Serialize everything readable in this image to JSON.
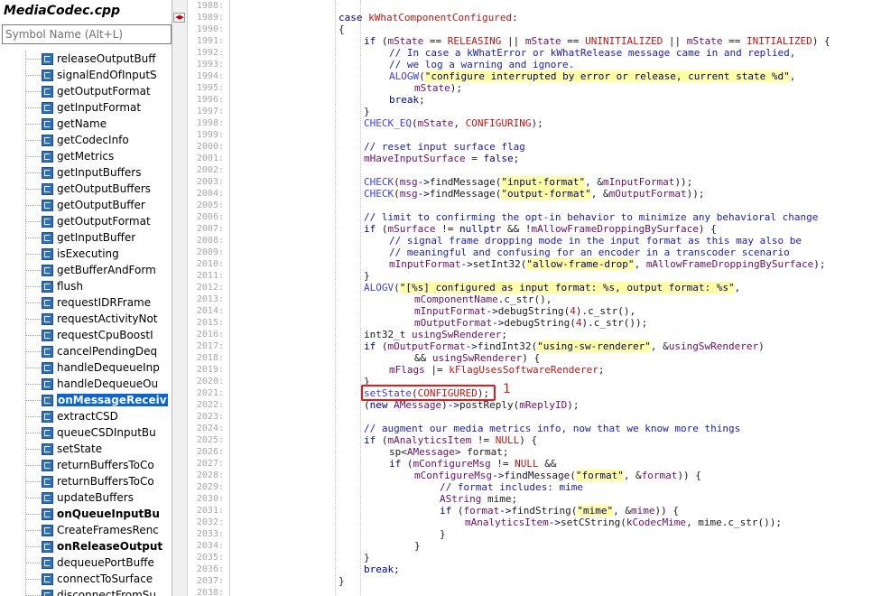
{
  "file_title": "MediaCodec.cpp",
  "search": {
    "placeholder": "Symbol Name (Alt+L)",
    "icon": "class-method-icon"
  },
  "symbols": [
    {
      "label": "releaseOutputBuff",
      "bold": false,
      "selected": false
    },
    {
      "label": "signalEndOfInputS",
      "bold": false,
      "selected": false
    },
    {
      "label": "getOutputFormat",
      "bold": false,
      "selected": false
    },
    {
      "label": "getInputFormat",
      "bold": false,
      "selected": false
    },
    {
      "label": "getName",
      "bold": false,
      "selected": false
    },
    {
      "label": "getCodecInfo",
      "bold": false,
      "selected": false
    },
    {
      "label": "getMetrics",
      "bold": false,
      "selected": false
    },
    {
      "label": "getInputBuffers",
      "bold": false,
      "selected": false
    },
    {
      "label": "getOutputBuffers",
      "bold": false,
      "selected": false
    },
    {
      "label": "getOutputBuffer",
      "bold": false,
      "selected": false
    },
    {
      "label": "getOutputFormat",
      "bold": false,
      "selected": false
    },
    {
      "label": "getInputBuffer",
      "bold": false,
      "selected": false
    },
    {
      "label": "isExecuting",
      "bold": false,
      "selected": false
    },
    {
      "label": "getBufferAndForm",
      "bold": false,
      "selected": false
    },
    {
      "label": "flush",
      "bold": false,
      "selected": false
    },
    {
      "label": "requestIDRFrame",
      "bold": false,
      "selected": false
    },
    {
      "label": "requestActivityNot",
      "bold": false,
      "selected": false
    },
    {
      "label": "requestCpuBoostI",
      "bold": false,
      "selected": false
    },
    {
      "label": "cancelPendingDeq",
      "bold": false,
      "selected": false
    },
    {
      "label": "handleDequeueInp",
      "bold": false,
      "selected": false
    },
    {
      "label": "handleDequeueOu",
      "bold": false,
      "selected": false
    },
    {
      "label": "onMessageReceiv",
      "bold": true,
      "selected": true
    },
    {
      "label": "extractCSD",
      "bold": false,
      "selected": false
    },
    {
      "label": "queueCSDInputBu",
      "bold": false,
      "selected": false
    },
    {
      "label": "setState",
      "bold": false,
      "selected": false
    },
    {
      "label": "returnBuffersToCo",
      "bold": false,
      "selected": false
    },
    {
      "label": "returnBuffersToCo",
      "bold": false,
      "selected": false
    },
    {
      "label": "updateBuffers",
      "bold": false,
      "selected": false
    },
    {
      "label": "onQueueInputBu",
      "bold": true,
      "selected": false
    },
    {
      "label": "CreateFramesRenc",
      "bold": false,
      "selected": false
    },
    {
      "label": "onReleaseOutput",
      "bold": true,
      "selected": false
    },
    {
      "label": "dequeuePortBuffe",
      "bold": false,
      "selected": false
    },
    {
      "label": "connectToSurface",
      "bold": false,
      "selected": false
    },
    {
      "label": "disconnectFromSu",
      "bold": false,
      "selected": false
    }
  ],
  "line_numbers": [
    "1988:",
    "1989:",
    "1990:",
    "1991:",
    "1992:",
    "1993:",
    "1994:",
    "1995:",
    "1996:",
    "1997:",
    "1998:",
    "1999:",
    "2000:",
    "2001:",
    "2002:",
    "2003:",
    "2004:",
    "2005:",
    "2006:",
    "2007:",
    "2008:",
    "2009:",
    "2010:",
    "2011:",
    "2012:",
    "2013:",
    "2014:",
    "2015:",
    "2016:",
    "2017:",
    "2018:",
    "2019:",
    "2020:",
    "2021:",
    "2022:",
    "2023:",
    "2024:",
    "2025:",
    "2026:",
    "2027:",
    "2028:",
    "2029:",
    "2030:",
    "2031:",
    "2032:",
    "2033:",
    "2034:",
    "2035:",
    "2036:",
    "2037:",
    "2038:"
  ],
  "code_lines": [
    {
      "indent": 0,
      "tokens": []
    },
    {
      "indent": 0,
      "tokens": [
        [
          "k",
          "case "
        ],
        [
          "m",
          "kWhatComponentConfigured"
        ],
        [
          "t",
          ":"
        ]
      ]
    },
    {
      "indent": 0,
      "tokens": [
        [
          "t",
          "{"
        ]
      ]
    },
    {
      "indent": 1,
      "tokens": [
        [
          "k",
          "if "
        ],
        [
          "t",
          "("
        ],
        [
          "v",
          "mState"
        ],
        [
          "t",
          " == "
        ],
        [
          "m",
          "RELEASING"
        ],
        [
          "t",
          " || "
        ],
        [
          "v",
          "mState"
        ],
        [
          "t",
          " == "
        ],
        [
          "m",
          "UNINITIALIZED"
        ],
        [
          "t",
          " || "
        ],
        [
          "v",
          "mState"
        ],
        [
          "t",
          " == "
        ],
        [
          "m",
          "INITIALIZED"
        ],
        [
          "t",
          ") {"
        ]
      ]
    },
    {
      "indent": 2,
      "tokens": [
        [
          "c",
          "// In case a kWhatError or kWhatRelease message came in and replied,"
        ]
      ]
    },
    {
      "indent": 2,
      "tokens": [
        [
          "c",
          "// we log a warning and ignore."
        ]
      ]
    },
    {
      "indent": 2,
      "tokens": [
        [
          "f",
          "ALOGW"
        ],
        [
          "t",
          "("
        ],
        [
          "s",
          "\"configure interrupted by error or release, current state %d\""
        ],
        [
          "t",
          ","
        ]
      ]
    },
    {
      "indent": 3,
      "tokens": [
        [
          "v",
          "mState"
        ],
        [
          "t",
          ");"
        ]
      ]
    },
    {
      "indent": 2,
      "tokens": [
        [
          "k",
          "break"
        ],
        [
          "t",
          ";"
        ]
      ]
    },
    {
      "indent": 1,
      "tokens": [
        [
          "t",
          "}"
        ]
      ]
    },
    {
      "indent": 1,
      "tokens": [
        [
          "f",
          "CHECK_EQ"
        ],
        [
          "t",
          "("
        ],
        [
          "v",
          "mState"
        ],
        [
          "t",
          ", "
        ],
        [
          "m",
          "CONFIGURING"
        ],
        [
          "t",
          ");"
        ]
      ]
    },
    {
      "indent": 0,
      "tokens": []
    },
    {
      "indent": 1,
      "tokens": [
        [
          "c",
          "// reset input surface flag"
        ]
      ]
    },
    {
      "indent": 1,
      "tokens": [
        [
          "v",
          "mHaveInputSurface"
        ],
        [
          "t",
          " = "
        ],
        [
          "k",
          "false"
        ],
        [
          "t",
          ";"
        ]
      ]
    },
    {
      "indent": 0,
      "tokens": []
    },
    {
      "indent": 1,
      "tokens": [
        [
          "f",
          "CHECK"
        ],
        [
          "t",
          "("
        ],
        [
          "v",
          "msg"
        ],
        [
          "p",
          "->"
        ],
        [
          "t",
          "findMessage("
        ],
        [
          "s",
          "\"input-format\""
        ],
        [
          "t",
          ", &"
        ],
        [
          "v",
          "mInputFormat"
        ],
        [
          "t",
          "));"
        ]
      ]
    },
    {
      "indent": 1,
      "tokens": [
        [
          "f",
          "CHECK"
        ],
        [
          "t",
          "("
        ],
        [
          "v",
          "msg"
        ],
        [
          "p",
          "->"
        ],
        [
          "t",
          "findMessage("
        ],
        [
          "s",
          "\"output-format\""
        ],
        [
          "t",
          ", &"
        ],
        [
          "v",
          "mOutputFormat"
        ],
        [
          "t",
          "));"
        ]
      ]
    },
    {
      "indent": 0,
      "tokens": []
    },
    {
      "indent": 1,
      "tokens": [
        [
          "c",
          "// limit to confirming the opt-in behavior to minimize any behavioral change"
        ]
      ]
    },
    {
      "indent": 1,
      "tokens": [
        [
          "k",
          "if "
        ],
        [
          "t",
          "("
        ],
        [
          "v",
          "mSurface"
        ],
        [
          "t",
          " != "
        ],
        [
          "k",
          "nullptr"
        ],
        [
          "t",
          " && !"
        ],
        [
          "v",
          "mAllowFrameDroppingBySurface"
        ],
        [
          "t",
          ") {"
        ]
      ]
    },
    {
      "indent": 2,
      "tokens": [
        [
          "c",
          "// signal frame dropping mode in the input format as this may also be"
        ]
      ]
    },
    {
      "indent": 2,
      "tokens": [
        [
          "c",
          "// meaningful and confusing for an encoder in a transcoder scenario"
        ]
      ]
    },
    {
      "indent": 2,
      "tokens": [
        [
          "v",
          "mInputFormat"
        ],
        [
          "p",
          "->"
        ],
        [
          "t",
          "setInt32("
        ],
        [
          "s",
          "\"allow-frame-drop\""
        ],
        [
          "t",
          ", "
        ],
        [
          "v",
          "mAllowFrameDroppingBySurface"
        ],
        [
          "t",
          ");"
        ]
      ]
    },
    {
      "indent": 1,
      "tokens": [
        [
          "t",
          "}"
        ]
      ]
    },
    {
      "indent": 1,
      "tokens": [
        [
          "f",
          "ALOGV"
        ],
        [
          "t",
          "("
        ],
        [
          "s",
          "\"[%s] configured as input format: %s, output format: %s\""
        ],
        [
          "t",
          ","
        ]
      ]
    },
    {
      "indent": 3,
      "tokens": [
        [
          "v",
          "mComponentName"
        ],
        [
          "t",
          ".c_str(),"
        ]
      ]
    },
    {
      "indent": 3,
      "tokens": [
        [
          "v",
          "mInputFormat"
        ],
        [
          "p",
          "->"
        ],
        [
          "t",
          "debugString("
        ],
        [
          "n",
          "4"
        ],
        [
          "t",
          ").c_str(),"
        ]
      ]
    },
    {
      "indent": 3,
      "tokens": [
        [
          "v",
          "mOutputFormat"
        ],
        [
          "p",
          "->"
        ],
        [
          "t",
          "debugString("
        ],
        [
          "n",
          "4"
        ],
        [
          "t",
          ").c_str());"
        ]
      ]
    },
    {
      "indent": 1,
      "tokens": [
        [
          "t",
          "int32_t "
        ],
        [
          "v",
          "usingSwRenderer"
        ],
        [
          "t",
          ";"
        ]
      ]
    },
    {
      "indent": 1,
      "tokens": [
        [
          "k",
          "if "
        ],
        [
          "t",
          "("
        ],
        [
          "v",
          "mOutputFormat"
        ],
        [
          "p",
          "->"
        ],
        [
          "t",
          "findInt32("
        ],
        [
          "s",
          "\"using-sw-renderer\""
        ],
        [
          "t",
          ", &"
        ],
        [
          "v",
          "usingSwRenderer"
        ],
        [
          "t",
          ")"
        ]
      ]
    },
    {
      "indent": 3,
      "tokens": [
        [
          "t",
          "&& "
        ],
        [
          "v",
          "usingSwRenderer"
        ],
        [
          "t",
          ") {"
        ]
      ]
    },
    {
      "indent": 2,
      "tokens": [
        [
          "v",
          "mFlags"
        ],
        [
          "t",
          " |= "
        ],
        [
          "m",
          "kFlagUsesSoftwareRenderer"
        ],
        [
          "t",
          ";"
        ]
      ]
    },
    {
      "indent": 1,
      "tokens": [
        [
          "t",
          "}"
        ]
      ]
    },
    {
      "indent": 1,
      "tokens": [
        [
          "f",
          "setState"
        ],
        [
          "t",
          "("
        ],
        [
          "m",
          "CONFIGURED"
        ],
        [
          "t",
          ");"
        ]
      ]
    },
    {
      "indent": 1,
      "tokens": [
        [
          "t",
          "("
        ],
        [
          "k",
          "new "
        ],
        [
          "v",
          "AMessage"
        ],
        [
          "t",
          ")"
        ],
        [
          "p",
          "->"
        ],
        [
          "t",
          "postReply("
        ],
        [
          "v",
          "mReplyID"
        ],
        [
          "t",
          ");"
        ]
      ]
    },
    {
      "indent": 0,
      "tokens": []
    },
    {
      "indent": 1,
      "tokens": [
        [
          "c",
          "// augment our media metrics info, now that we know more things"
        ]
      ]
    },
    {
      "indent": 1,
      "tokens": [
        [
          "k",
          "if "
        ],
        [
          "t",
          "("
        ],
        [
          "v",
          "mAnalyticsItem"
        ],
        [
          "t",
          " != "
        ],
        [
          "m",
          "NULL"
        ],
        [
          "t",
          ") {"
        ]
      ]
    },
    {
      "indent": 2,
      "tokens": [
        [
          "t",
          "sp<"
        ],
        [
          "v",
          "AMessage"
        ],
        [
          "t",
          "> format;"
        ]
      ]
    },
    {
      "indent": 2,
      "tokens": [
        [
          "k",
          "if "
        ],
        [
          "t",
          "("
        ],
        [
          "v",
          "mConfigureMsg"
        ],
        [
          "t",
          " != "
        ],
        [
          "m",
          "NULL"
        ],
        [
          "t",
          " &&"
        ]
      ]
    },
    {
      "indent": 3,
      "tokens": [
        [
          "v",
          "mConfigureMsg"
        ],
        [
          "p",
          "->"
        ],
        [
          "t",
          "findMessage("
        ],
        [
          "s",
          "\"format\""
        ],
        [
          "t",
          ", &"
        ],
        [
          "v",
          "format"
        ],
        [
          "t",
          ")) {"
        ]
      ]
    },
    {
      "indent": 4,
      "tokens": [
        [
          "c",
          "// format includes: mime"
        ]
      ]
    },
    {
      "indent": 4,
      "tokens": [
        [
          "v",
          "AString"
        ],
        [
          "t",
          " mime;"
        ]
      ]
    },
    {
      "indent": 4,
      "tokens": [
        [
          "k",
          "if "
        ],
        [
          "t",
          "("
        ],
        [
          "v",
          "format"
        ],
        [
          "p",
          "->"
        ],
        [
          "t",
          "findString("
        ],
        [
          "s",
          "\"mime\""
        ],
        [
          "t",
          ", &"
        ],
        [
          "v",
          "mime"
        ],
        [
          "t",
          ")) {"
        ]
      ]
    },
    {
      "indent": 5,
      "tokens": [
        [
          "v",
          "mAnalyticsItem"
        ],
        [
          "p",
          "->"
        ],
        [
          "t",
          "setCString("
        ],
        [
          "v",
          "kCodecMime"
        ],
        [
          "t",
          ", mime.c_str());"
        ]
      ]
    },
    {
      "indent": 4,
      "tokens": [
        [
          "t",
          "}"
        ]
      ]
    },
    {
      "indent": 3,
      "tokens": [
        [
          "t",
          "}"
        ]
      ]
    },
    {
      "indent": 1,
      "tokens": [
        [
          "t",
          "}"
        ]
      ]
    },
    {
      "indent": 1,
      "tokens": [
        [
          "k",
          "break"
        ],
        [
          "t",
          ";"
        ]
      ]
    },
    {
      "indent": 0,
      "tokens": [
        [
          "t",
          "}"
        ]
      ]
    },
    {
      "indent": 0,
      "tokens": []
    }
  ],
  "annotation": {
    "number": "1",
    "color": "#e21b1b",
    "target_line_index": 33
  },
  "colors": {
    "selection": "#0a64d6",
    "string_highlight": "#ffffa4",
    "keyword": "#00009a",
    "macro": "#c31414"
  }
}
